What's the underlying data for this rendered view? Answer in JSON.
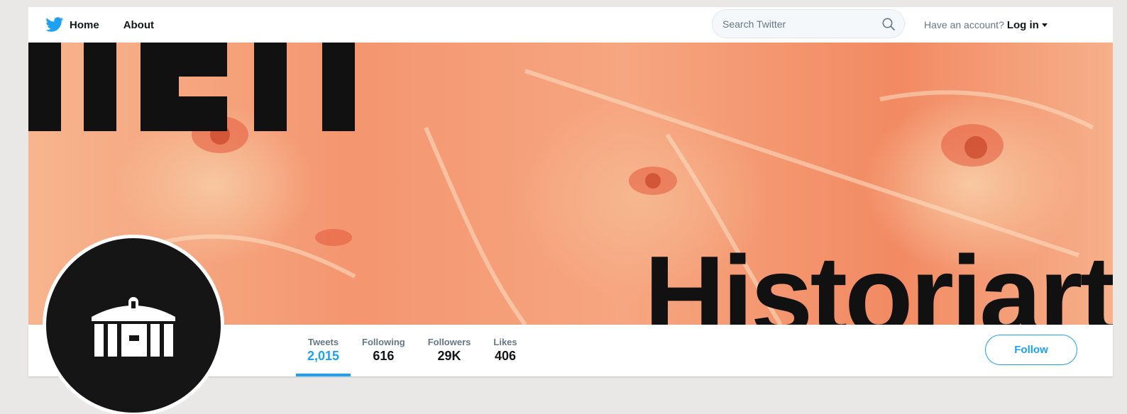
{
  "nav": {
    "home_label": "Home",
    "about_label": "About",
    "search_placeholder": "Search Twitter",
    "have_account_text": "Have an account?",
    "login_label": "Log in"
  },
  "banner": {
    "brand_word": "Historiart"
  },
  "profile": {
    "stats": [
      {
        "label": "Tweets",
        "value": "2,015"
      },
      {
        "label": "Following",
        "value": "616"
      },
      {
        "label": "Followers",
        "value": "29K"
      },
      {
        "label": "Likes",
        "value": "406"
      }
    ],
    "follow_label": "Follow"
  },
  "colors": {
    "accent": "#1da1f2",
    "banner_orange": "#f28a63",
    "logo_black": "#151515"
  },
  "icons": {
    "nav_bird": "twitter-bird-icon",
    "search": "search-icon",
    "caret": "caret-down-icon",
    "avatar_logo": "temple-logo-icon"
  }
}
